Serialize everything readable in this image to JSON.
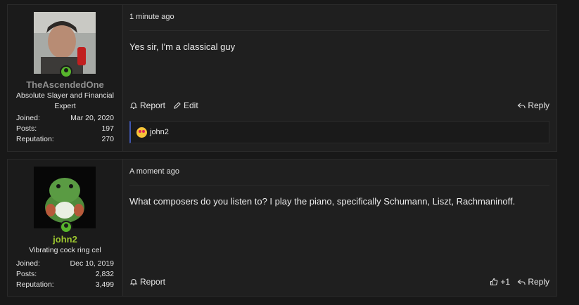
{
  "posts": [
    {
      "username": "TheAscendedOne",
      "user_title": "Absolute Slayer and Financial Expert",
      "stats": [
        {
          "label": "Joined:",
          "value": "Mar 20, 2020"
        },
        {
          "label": "Posts:",
          "value": "197"
        },
        {
          "label": "Reputation:",
          "value": "270"
        }
      ],
      "timestamp": "1 minute ago",
      "message": "Yes sir, I'm a classical guy",
      "actions": {
        "report": "Report",
        "edit": "Edit",
        "reply": "Reply"
      },
      "reactions": {
        "users": "john2"
      }
    },
    {
      "username": "john2",
      "user_title": "Vibrating cock ring cel",
      "stats": [
        {
          "label": "Joined:",
          "value": "Dec 10, 2019"
        },
        {
          "label": "Posts:",
          "value": "2,832"
        },
        {
          "label": "Reputation:",
          "value": "3,499"
        }
      ],
      "timestamp": "A moment ago",
      "message": "What composers do you listen to? I play the piano, specifically Schumann, Liszt, Rachmaninoff.",
      "actions": {
        "report": "Report",
        "like": "+1",
        "reply": "Reply"
      }
    }
  ],
  "colors": {
    "online": "#57b52c",
    "username2": "#9ec82f",
    "reaction_bar": "#3f56b0"
  }
}
